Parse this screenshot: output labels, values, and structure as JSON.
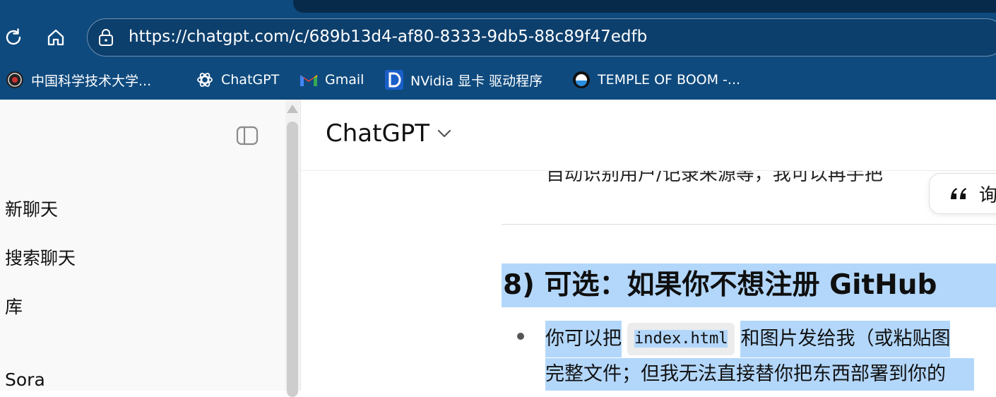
{
  "browser": {
    "url": "https://chatgpt.com/c/689b13d4-af80-8333-9db5-88c89f47edfb",
    "bookmarks": [
      {
        "label": "中国科学技术大学...",
        "icon": "ustc-icon"
      },
      {
        "label": "ChatGPT",
        "icon": "openai-icon"
      },
      {
        "label": "Gmail",
        "icon": "gmail-icon"
      },
      {
        "label": "NVidia 显卡 驱动程序",
        "icon": "d-letter-icon"
      },
      {
        "label": "TEMPLE OF BOOM -...",
        "icon": "temple-icon"
      }
    ]
  },
  "sidebar": {
    "items": [
      {
        "label": "新聊天"
      },
      {
        "label": "搜索聊天"
      },
      {
        "label": "库"
      },
      {
        "label": "Sora"
      }
    ]
  },
  "main": {
    "model_name": "ChatGPT",
    "cut_text": "自动识别用户/记录来源等，我可以再手把",
    "quote_label": "询",
    "heading": "8) 可选：如果你不想注册 GitHub",
    "bullet": {
      "text_before": "你可以把",
      "code": "index.html",
      "text_after": "和图片发给我（或粘贴图",
      "line2": "完整文件；但我无法直接替你把东西部署到你的"
    }
  },
  "colors": {
    "chrome": "#0e4a7e",
    "selection": "#b3d7fb"
  }
}
